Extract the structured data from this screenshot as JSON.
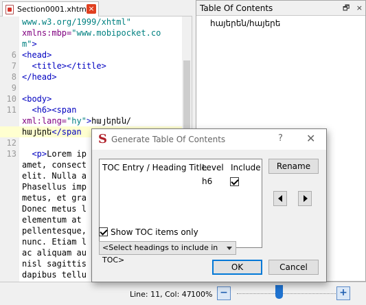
{
  "editor": {
    "tab_name": "Section0001.xhtml",
    "close_glyph": "×",
    "lines": [
      {
        "n": "",
        "parts": [
          {
            "c": "val",
            "t": "www.w3.org/1999/xhtml\""
          }
        ]
      },
      {
        "n": "",
        "parts": [
          {
            "c": "attr",
            "t": "xmlns:mbp="
          },
          {
            "c": "val",
            "t": "\"www.mobipocket.co"
          }
        ]
      },
      {
        "n": "",
        "parts": [
          {
            "c": "val",
            "t": "m\""
          },
          {
            "c": "tag",
            "t": ">"
          }
        ]
      },
      {
        "n": "6",
        "parts": [
          {
            "c": "tag",
            "t": "<head>"
          }
        ]
      },
      {
        "n": "7",
        "parts": [
          {
            "c": "tag",
            "t": "  <title></title>"
          }
        ]
      },
      {
        "n": "8",
        "parts": [
          {
            "c": "tag",
            "t": "</head>"
          }
        ]
      },
      {
        "n": "9",
        "parts": []
      },
      {
        "n": "10",
        "parts": [
          {
            "c": "tag",
            "t": "<body>"
          }
        ]
      },
      {
        "n": "11",
        "parts": [
          {
            "c": "tag",
            "t": "  <h6><span"
          }
        ]
      },
      {
        "n": "",
        "parts": [
          {
            "c": "attr",
            "t": "xml:lang="
          },
          {
            "c": "val",
            "t": "\"hy\""
          },
          {
            "c": "tag",
            "t": ">"
          },
          {
            "c": "txt",
            "t": "հայերեն/"
          }
        ]
      },
      {
        "n": "",
        "hl": true,
        "parts": [
          {
            "c": "txt",
            "t": "հայերե"
          },
          {
            "c": "tag",
            "t": "</span"
          }
        ]
      },
      {
        "n": "12",
        "parts": []
      },
      {
        "n": "13",
        "parts": [
          {
            "c": "tag",
            "t": "  <p>"
          },
          {
            "c": "txt",
            "t": "Lorem ip"
          }
        ]
      },
      {
        "n": "",
        "parts": [
          {
            "c": "txt",
            "t": "amet, consect"
          }
        ]
      },
      {
        "n": "",
        "parts": [
          {
            "c": "txt",
            "t": "elit. Nulla a"
          }
        ]
      },
      {
        "n": "",
        "parts": [
          {
            "c": "txt",
            "t": "Phasellus imp"
          }
        ]
      },
      {
        "n": "",
        "parts": [
          {
            "c": "txt",
            "t": "metus, et gra"
          }
        ]
      },
      {
        "n": "",
        "parts": [
          {
            "c": "txt",
            "t": "Donec metus l"
          }
        ]
      },
      {
        "n": "",
        "parts": [
          {
            "c": "txt",
            "t": "elementum at"
          }
        ]
      },
      {
        "n": "",
        "parts": [
          {
            "c": "txt",
            "t": "pellentesque,"
          }
        ]
      },
      {
        "n": "",
        "parts": [
          {
            "c": "txt",
            "t": "nunc. Etiam l"
          }
        ]
      },
      {
        "n": "",
        "parts": [
          {
            "c": "txt",
            "t": "ac aliquam au"
          }
        ]
      },
      {
        "n": "",
        "parts": [
          {
            "c": "txt",
            "t": "nisl sagittis"
          }
        ]
      },
      {
        "n": "",
        "parts": [
          {
            "c": "txt",
            "t": "dapibus tellu"
          }
        ]
      }
    ]
  },
  "toc_panel": {
    "title": "Table Of Contents",
    "float_glyph": "🗗",
    "close_glyph": "×",
    "entry": "հայերեն/հայերե"
  },
  "status": {
    "position": "Line: 11, Col: 47",
    "zoom": "100%",
    "zoom_out": "−",
    "zoom_in": "+",
    "zoom_level": 0.43
  },
  "dialog": {
    "logo": "S",
    "title": "Generate Table Of Contents",
    "help": "?",
    "close": "✕",
    "col_entry": "TOC Entry / Heading Title",
    "col_level": "Level",
    "col_include": "Include",
    "row_level": "h6",
    "row_include": true,
    "rename": "Rename",
    "show_toc_label": "Show TOC items only",
    "show_toc_checked": true,
    "select_headings": "<Select headings to include in TOC>",
    "ok": "OK",
    "cancel": "Cancel"
  }
}
